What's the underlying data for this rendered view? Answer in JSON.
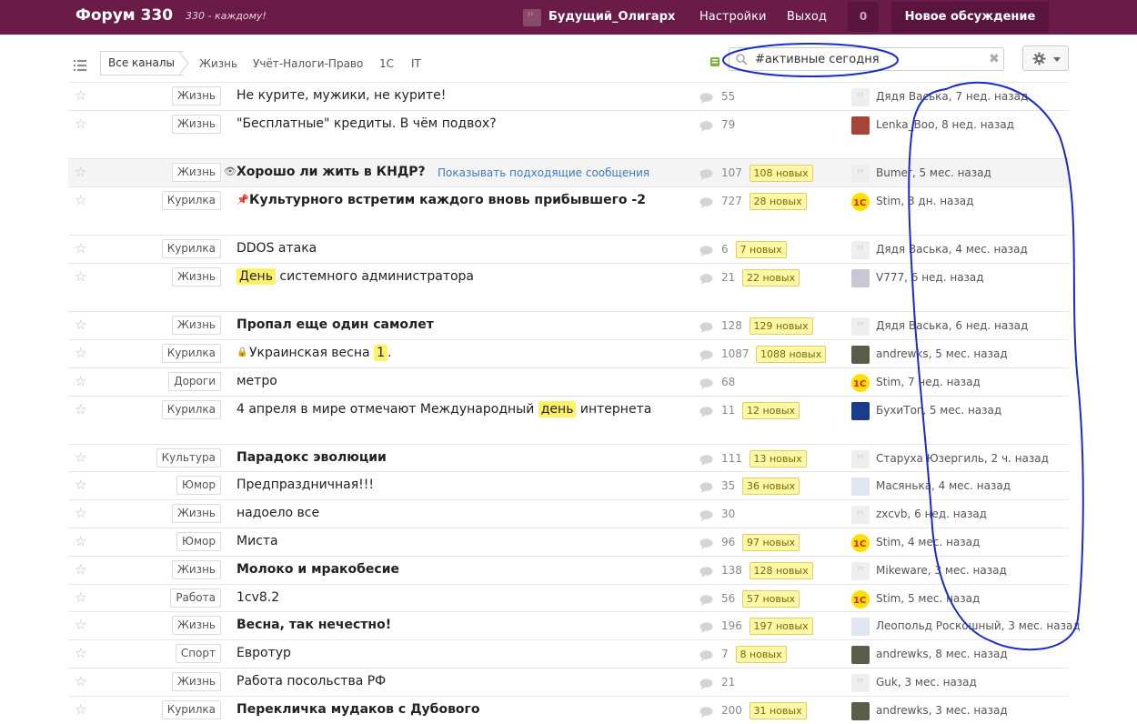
{
  "header": {
    "brand": "Форум 330",
    "tagline": "330 - каждому!",
    "username": "Будущий_Олигарх",
    "settings": "Настройки",
    "logout": "Выход",
    "notifications": "0",
    "new_discussion": "Новое обсуждение",
    "bg_color": "#6b1b48"
  },
  "toolbar": {
    "all_channels": "Все каналы",
    "channels": [
      "Жизнь",
      "Учёт-Налоги-Право",
      "1С",
      "IT"
    ],
    "search_value": "#активные сегодня"
  },
  "topics": [
    {
      "tag": "Жизнь",
      "title": "Не курите, мужики, не курите!",
      "bold": false,
      "comments": "55",
      "new": "",
      "author": "Дядя Васька, 7 нед. назад",
      "avatar": "quote"
    },
    {
      "tag": "Жизнь",
      "title": "\"Бесплатные\" кредиты. В чём подвох?",
      "bold": false,
      "comments": "79",
      "new": "",
      "author": "Lenka_Boo, 8 нед. назад",
      "avatar": "red"
    },
    {
      "tag": "Жизнь",
      "title": "Хорошо ли жить в КНДР?",
      "bold": true,
      "comments": "107",
      "new": "108 новых",
      "author": "Bumer, 5 мес. назад",
      "avatar": "quote",
      "link": "Показывать подходящие сообщения"
    },
    {
      "tag": "Курилка",
      "title": "Культурного встретим каждого вновь прибывшего -2",
      "bold": true,
      "comments": "727",
      "new": "28 новых",
      "author": "Stim, 3 дн. назад",
      "avatar": "1c"
    },
    {
      "tag": "Курилка",
      "title": "DDOS атака",
      "bold": false,
      "comments": "6",
      "new": "7 новых",
      "author": "Дядя Васька, 4 мес. назад",
      "avatar": "quote"
    },
    {
      "tag": "Жизнь",
      "title_pre": "",
      "title_hl": "День",
      "title_post": " системного администратора",
      "bold": false,
      "comments": "21",
      "new": "22 новых",
      "author": "V777, 6 нед. назад",
      "avatar": "light"
    },
    {
      "tag": "Жизнь",
      "title": "Пропал еще один самолет",
      "bold": true,
      "comments": "128",
      "new": "129 новых",
      "author": "Дядя Васька, 6 нед. назад",
      "avatar": "quote"
    },
    {
      "tag": "Курилка",
      "title_pre": "Украинская весна ",
      "title_hl": "1",
      "title_post": ".",
      "bold": false,
      "comments": "1087",
      "new": "1088 новых",
      "author": "andrewks, 5 мес. назад",
      "avatar": "photo"
    },
    {
      "tag": "Дороги",
      "title": "метро",
      "bold": false,
      "comments": "68",
      "new": "",
      "author": "Stim, 7 нед. назад",
      "avatar": "1c"
    },
    {
      "tag": "Курилка",
      "title_pre": "4 апреля в мире отмечают Международный ",
      "title_hl": "день",
      "title_post": " интернета",
      "bold": false,
      "comments": "11",
      "new": "12 новых",
      "author": "БухиТог, 5 мес. назад",
      "avatar": "blue"
    },
    {
      "tag": "Культура",
      "title": "Парадокс эволюции",
      "bold": true,
      "comments": "111",
      "new": "13 новых",
      "author": "Старуха Юзергиль, 2 ч. назад",
      "avatar": "quote"
    },
    {
      "tag": "Юмор",
      "title": "Предпраздничная!!!",
      "bold": false,
      "comments": "35",
      "new": "36 новых",
      "author": "Масянька, 4 мес. назад",
      "avatar": "pale"
    },
    {
      "tag": "Жизнь",
      "title": "надоело все",
      "bold": false,
      "comments": "30",
      "new": "",
      "author": "zxcvb, 6 нед. назад",
      "avatar": "quote"
    },
    {
      "tag": "Юмор",
      "title": "Миста",
      "bold": false,
      "comments": "96",
      "new": "97 новых",
      "author": "Stim, 4 мес. назад",
      "avatar": "1c"
    },
    {
      "tag": "Жизнь",
      "title": "Молоко и мракобесие",
      "bold": true,
      "comments": "138",
      "new": "128 новых",
      "author": "Mikeware, 3 мес. назад",
      "avatar": "quote"
    },
    {
      "tag": "Работа",
      "title": "1cv8.2",
      "bold": false,
      "comments": "56",
      "new": "57 новых",
      "author": "Stim, 5 мес. назад",
      "avatar": "1c"
    },
    {
      "tag": "Жизнь",
      "title": "Весна, так нечестно!",
      "bold": true,
      "comments": "196",
      "new": "197 новых",
      "author": "Леопольд Роскошный, 3 мес. назад",
      "avatar": "pale"
    },
    {
      "tag": "Спорт",
      "title": "Евротур",
      "bold": false,
      "comments": "7",
      "new": "8 новых",
      "author": "andrewks, 8 мес. назад",
      "avatar": "photo"
    },
    {
      "tag": "Жизнь",
      "title": "Работа посольства РФ",
      "bold": false,
      "comments": "21",
      "new": "",
      "author": "Guk, 3 мес. назад",
      "avatar": "quote"
    },
    {
      "tag": "Курилка",
      "title": "Перекличка мудаков с Дубового",
      "bold": true,
      "comments": "200",
      "new": "31 новых",
      "author": "andrewks, 3 мес. назад",
      "avatar": "photo"
    }
  ]
}
